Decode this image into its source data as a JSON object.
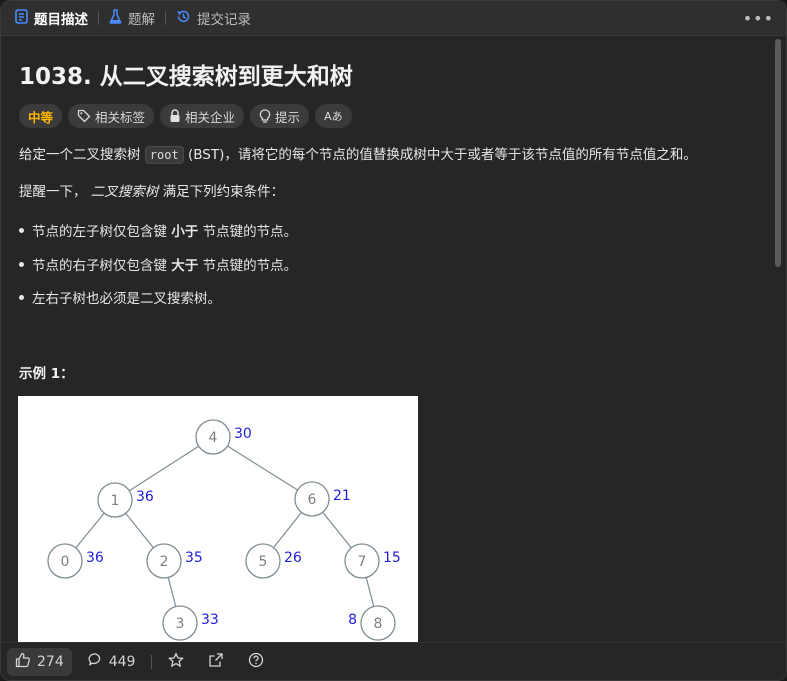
{
  "tabs": [
    {
      "label": "题目描述",
      "icon": "description-icon",
      "active": true
    },
    {
      "label": "题解",
      "icon": "flask-icon",
      "active": false
    },
    {
      "label": "提交记录",
      "icon": "history-icon",
      "active": false
    }
  ],
  "problem": {
    "title": "1038. 从二叉搜索树到更大和树",
    "chips": {
      "difficulty": "中等",
      "tags": "相关标签",
      "companies": "相关企业",
      "hint": "提示",
      "translate": "Aあ"
    },
    "desc": {
      "p1_a": "给定一个二叉搜索树 ",
      "p1_code": "root",
      "p1_b": " (BST)，请将它的每个节点的值替换成树中大于或者等于该节点值的所有节点值之和。",
      "p2_a": "提醒一下， ",
      "p2_em": "二叉搜索树",
      "p2_b": " 满足下列约束条件："
    },
    "bullets": [
      {
        "a": "节点的左子树仅包含键 ",
        "b": "小于",
        "c": " 节点键的节点。"
      },
      {
        "a": "节点的右子树仅包含键 ",
        "b": "大于",
        "c": " 节点键的节点。"
      },
      {
        "a": "左右子树也必须是二叉搜索树。",
        "b": "",
        "c": ""
      }
    ],
    "example_label": "示例 1："
  },
  "tree": {
    "nodes": [
      {
        "id": "n4",
        "val": "4",
        "sum": "30"
      },
      {
        "id": "n1",
        "val": "1",
        "sum": "36"
      },
      {
        "id": "n6",
        "val": "6",
        "sum": "21"
      },
      {
        "id": "n0",
        "val": "0",
        "sum": "36"
      },
      {
        "id": "n2",
        "val": "2",
        "sum": "35"
      },
      {
        "id": "n5",
        "val": "5",
        "sum": "26"
      },
      {
        "id": "n7",
        "val": "7",
        "sum": "15"
      },
      {
        "id": "n3",
        "val": "3",
        "sum": "33"
      },
      {
        "id": "n8",
        "val": "8",
        "sum": "8"
      }
    ],
    "colors": {
      "node_stroke": "#7f8c93",
      "edge": "#7f8c93",
      "value": "#7f7f7f",
      "sum": "#1f1fd6"
    }
  },
  "footer": {
    "likes": "274",
    "comments": "449"
  },
  "colors": {
    "accent_blue": "#4a8cff",
    "difficulty": "#ffb700",
    "background": "#262626"
  }
}
